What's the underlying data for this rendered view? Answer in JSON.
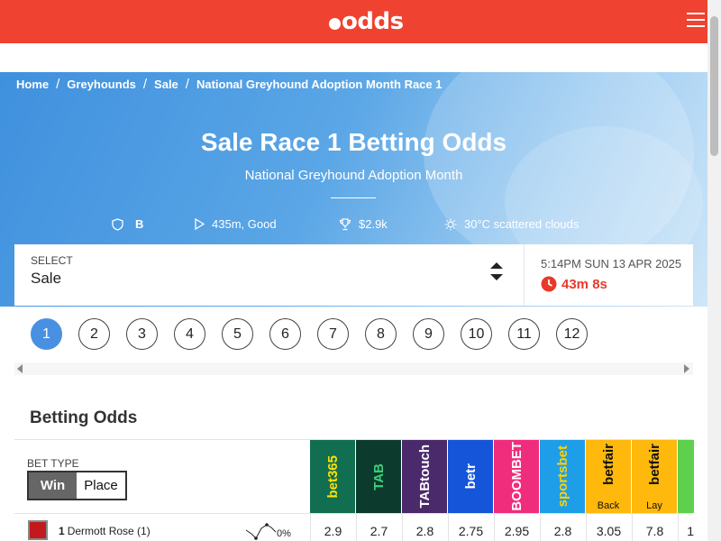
{
  "header": {
    "logo": "odds"
  },
  "breadcrumb": [
    {
      "label": "Home"
    },
    {
      "label": "Greyhounds"
    },
    {
      "label": "Sale"
    },
    {
      "label": "National Greyhound Adoption Month Race 1"
    }
  ],
  "breadcrumb_separator": "/",
  "hero": {
    "title": "Sale Race 1 Betting Odds",
    "subtitle": "National Greyhound Adoption Month",
    "stats": {
      "grade": "B",
      "distance": "435m, Good",
      "prize": "$2.9k",
      "weather": "30°C scattered clouds"
    }
  },
  "select": {
    "label": "SELECT",
    "value": "Sale"
  },
  "race_time": {
    "datetime": "5:14PM SUN 13 APR 2025",
    "countdown": "43m 8s"
  },
  "races": [
    "1",
    "2",
    "3",
    "4",
    "5",
    "6",
    "7",
    "8",
    "9",
    "10",
    "11",
    "12"
  ],
  "active_race": "1",
  "betting": {
    "title": "Betting Odds",
    "bet_type_label": "BET TYPE",
    "win_label": "Win",
    "place_label": "Place",
    "bookmakers": [
      {
        "name": "bet365",
        "bg": "#126e51",
        "fg": "#ffe200",
        "sub": ""
      },
      {
        "name": "TAB",
        "bg": "#0c3b2e",
        "fg": "#3fd17a",
        "sub": ""
      },
      {
        "name": "TABtouch",
        "bg": "#4b2a6b",
        "fg": "#ffffff",
        "sub": ""
      },
      {
        "name": "betr",
        "bg": "#1455d9",
        "fg": "#ffffff",
        "sub": ""
      },
      {
        "name": "BOOMBET",
        "bg": "#f02d7d",
        "fg": "#ffffff",
        "sub": ""
      },
      {
        "name": "sportsbet",
        "bg": "#1e9ee8",
        "fg": "#ffd200",
        "sub": ""
      },
      {
        "name": "betfair",
        "bg": "#ffb80c",
        "fg": "#111111",
        "sub": "Back"
      },
      {
        "name": "betfair",
        "bg": "#ffb80c",
        "fg": "#111111",
        "sub": "Lay"
      }
    ],
    "partial_bookmaker_color": "#5ed04e",
    "runners": [
      {
        "number": "1",
        "name": "Dermott Rose (1)",
        "percent": "0%",
        "silk_color": "#c2191d",
        "odds": [
          "2.9",
          "2.7",
          "2.8",
          "2.75",
          "2.95",
          "2.8",
          "3.05",
          "7.8"
        ],
        "partial_odd": "1"
      }
    ]
  }
}
